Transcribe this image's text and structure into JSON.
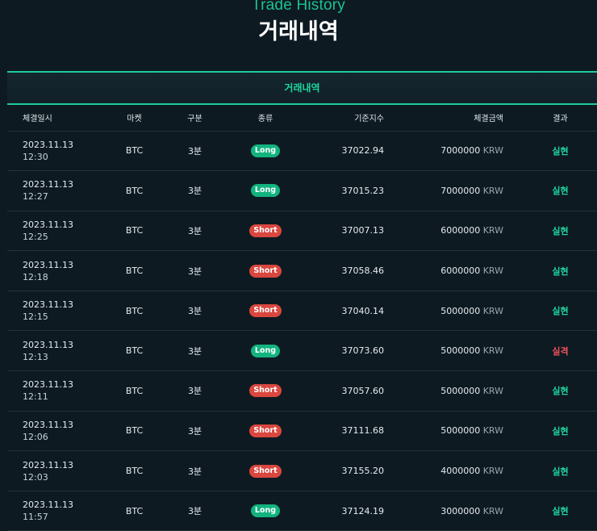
{
  "header": {
    "title_en": "Trade History",
    "title_ko": "거래내역"
  },
  "panel": {
    "title": "거래내역",
    "columns": [
      "체결일시",
      "마켓",
      "구분",
      "종류",
      "기준지수",
      "체결금액",
      "결과"
    ],
    "rows": [
      {
        "date": "2023.11.13",
        "time": "12:30",
        "market": "BTC",
        "interval": "3분",
        "type": "Long",
        "index": "37022.94",
        "amount": "7000000",
        "unit": "KRW",
        "result": "실현"
      },
      {
        "date": "2023.11.13",
        "time": "12:27",
        "market": "BTC",
        "interval": "3분",
        "type": "Long",
        "index": "37015.23",
        "amount": "7000000",
        "unit": "KRW",
        "result": "실현"
      },
      {
        "date": "2023.11.13",
        "time": "12:25",
        "market": "BTC",
        "interval": "3분",
        "type": "Short",
        "index": "37007.13",
        "amount": "6000000",
        "unit": "KRW",
        "result": "실현"
      },
      {
        "date": "2023.11.13",
        "time": "12:18",
        "market": "BTC",
        "interval": "3분",
        "type": "Short",
        "index": "37058.46",
        "amount": "6000000",
        "unit": "KRW",
        "result": "실현"
      },
      {
        "date": "2023.11.13",
        "time": "12:15",
        "market": "BTC",
        "interval": "3분",
        "type": "Short",
        "index": "37040.14",
        "amount": "5000000",
        "unit": "KRW",
        "result": "실현"
      },
      {
        "date": "2023.11.13",
        "time": "12:13",
        "market": "BTC",
        "interval": "3분",
        "type": "Long",
        "index": "37073.60",
        "amount": "5000000",
        "unit": "KRW",
        "result": "실격"
      },
      {
        "date": "2023.11.13",
        "time": "12:11",
        "market": "BTC",
        "interval": "3분",
        "type": "Short",
        "index": "37057.60",
        "amount": "5000000",
        "unit": "KRW",
        "result": "실현"
      },
      {
        "date": "2023.11.13",
        "time": "12:06",
        "market": "BTC",
        "interval": "3분",
        "type": "Short",
        "index": "37111.68",
        "amount": "5000000",
        "unit": "KRW",
        "result": "실현"
      },
      {
        "date": "2023.11.13",
        "time": "12:03",
        "market": "BTC",
        "interval": "3분",
        "type": "Short",
        "index": "37155.20",
        "amount": "4000000",
        "unit": "KRW",
        "result": "실현"
      },
      {
        "date": "2023.11.13",
        "time": "11:57",
        "market": "BTC",
        "interval": "3분",
        "type": "Long",
        "index": "37124.19",
        "amount": "3000000",
        "unit": "KRW",
        "result": "실현"
      }
    ]
  },
  "colors": {
    "background": "#0e1a22",
    "accent": "#1fc99a",
    "long": "#12b37e",
    "short": "#d9473f",
    "win": "#1fd69f",
    "lose": "#f0515a"
  }
}
